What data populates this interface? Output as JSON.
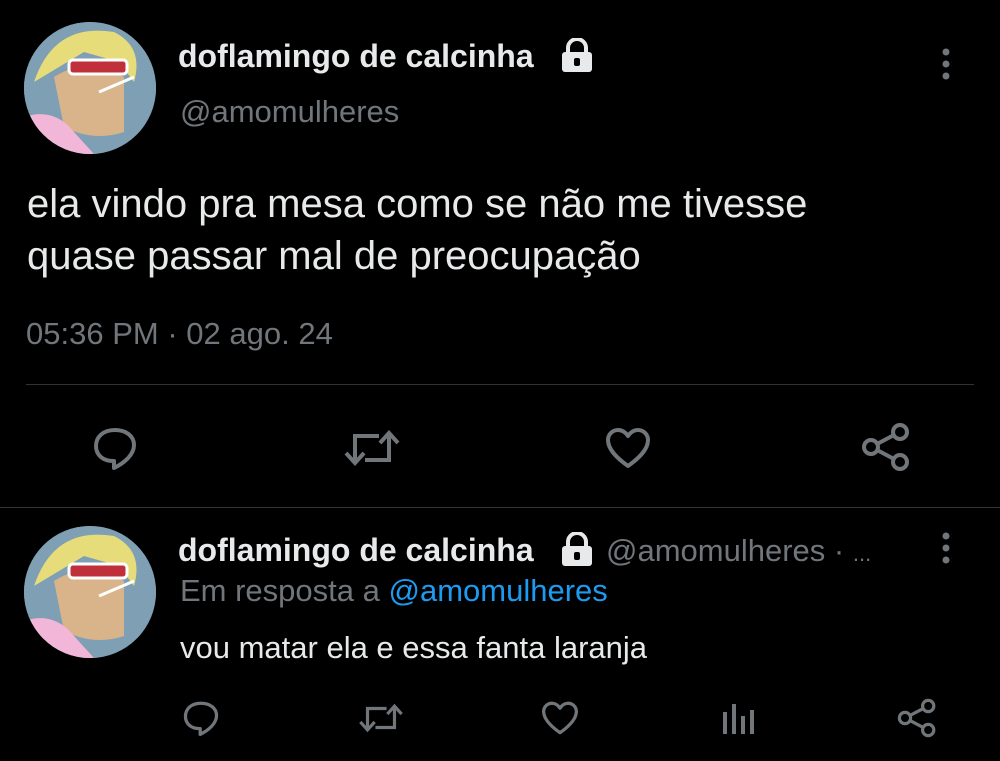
{
  "main_tweet": {
    "display_name": "doflamingo de calcinha",
    "handle": "@amomulheres",
    "text_line1": "ela vindo pra mesa como se não me tivesse",
    "text_line2": "quase passar mal de preocupação",
    "time": "05:36 PM",
    "separator": "·",
    "date": "02 ago. 24"
  },
  "reply": {
    "display_name": "doflamingo de calcinha",
    "handle": "@amomulheres",
    "separator": "·",
    "ellipsis": "...",
    "reply_prefix": "Em resposta a",
    "reply_to": "@amomulheres",
    "text": "vou matar ela e essa fanta laranja"
  },
  "icons": [
    "more-vert-icon",
    "lock-icon",
    "reply-icon",
    "retweet-icon",
    "like-icon",
    "share-icon",
    "analytics-icon"
  ],
  "colors": {
    "background": "#000000",
    "text": "#e7e9ea",
    "muted": "#71767b",
    "link": "#1d9bf0",
    "divider": "#2f3336"
  }
}
